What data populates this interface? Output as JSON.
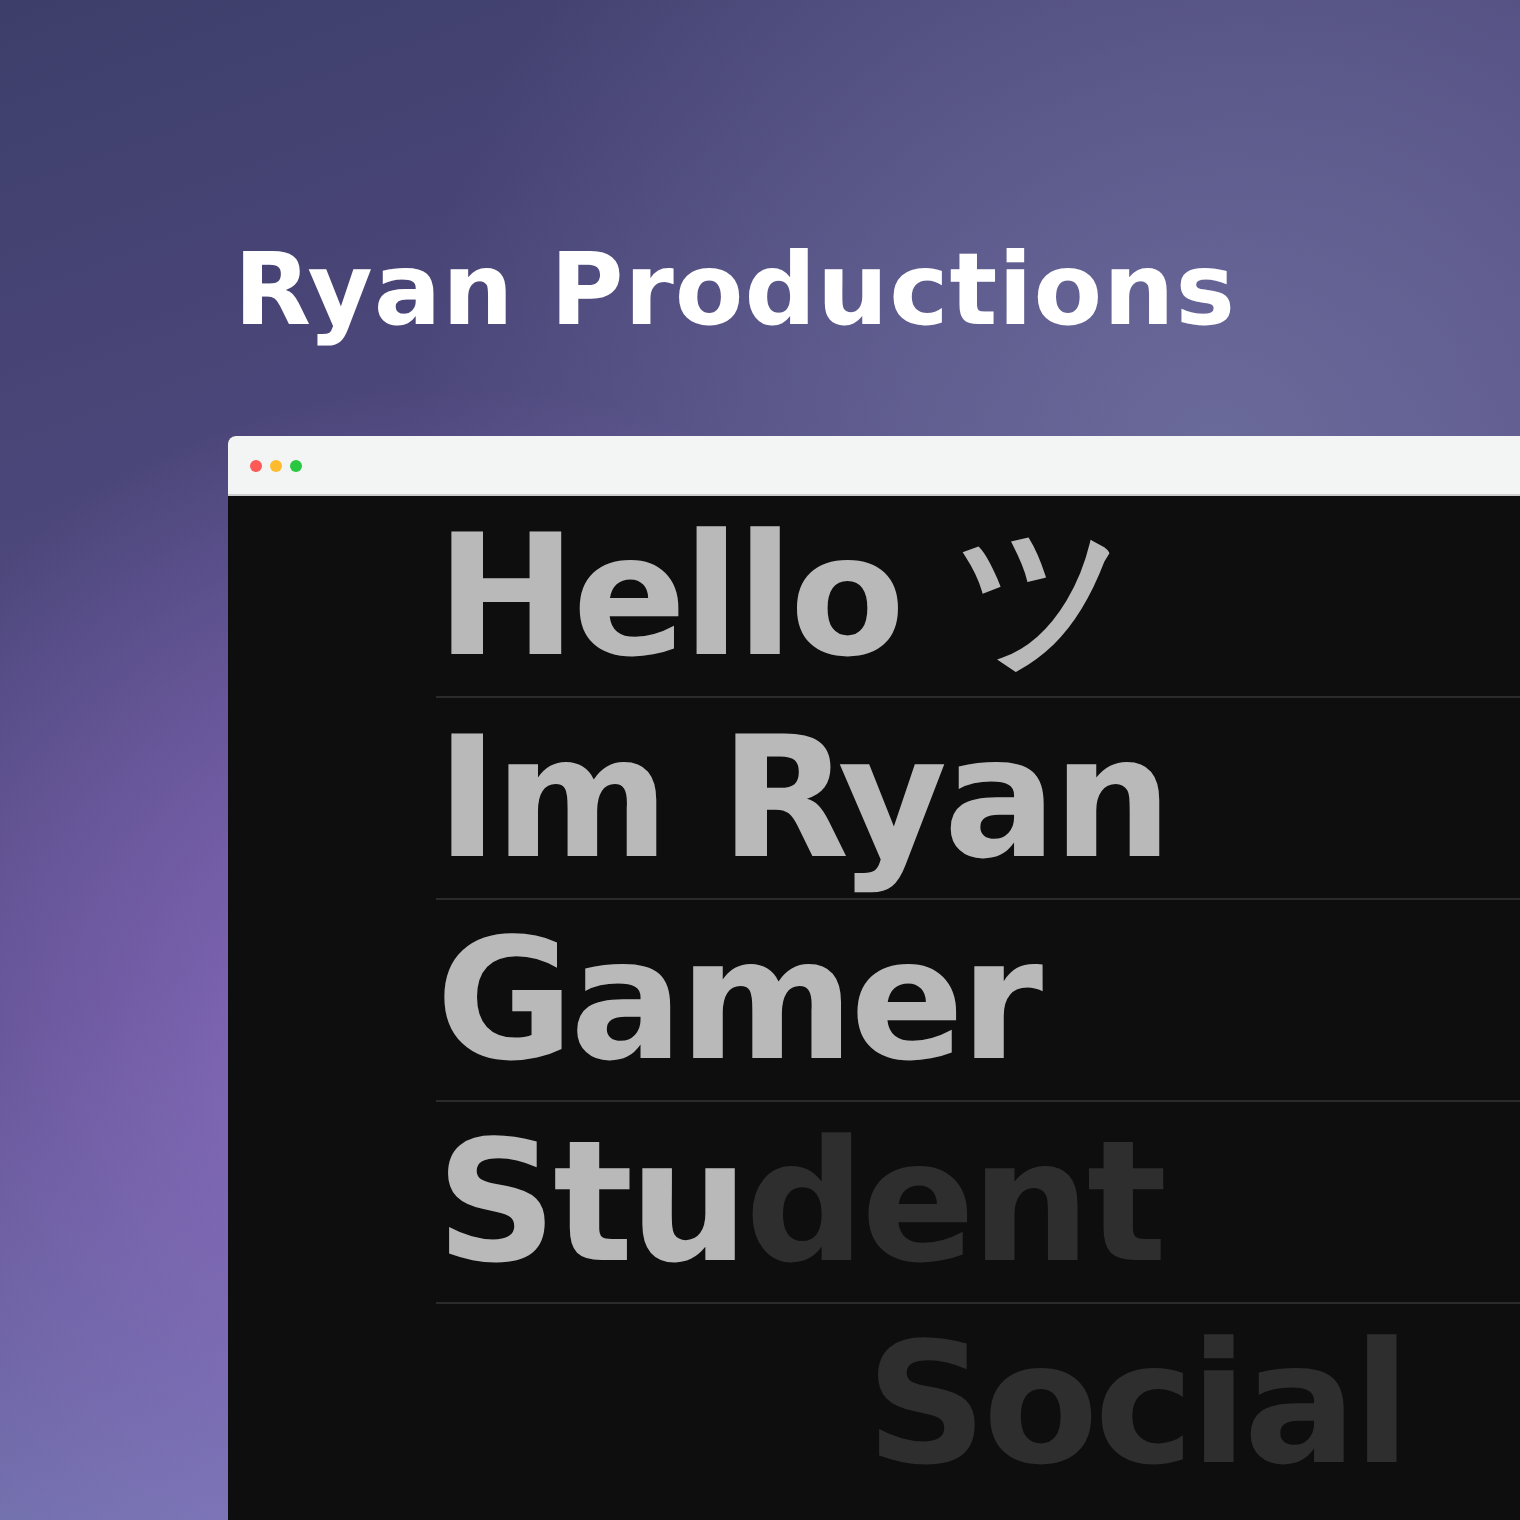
{
  "title": "Ryan Productions",
  "browser": {
    "lines": [
      {
        "kind": "static",
        "segments": [
          {
            "text": "Hello ツ",
            "lit": true
          }
        ]
      },
      {
        "kind": "static",
        "segments": [
          {
            "text": "Im Ryan",
            "lit": true
          }
        ]
      },
      {
        "kind": "static",
        "segments": [
          {
            "text": "Gamer",
            "lit": true
          }
        ]
      },
      {
        "kind": "static",
        "segments": [
          {
            "text": "Stu",
            "lit": true
          },
          {
            "text": "dent",
            "lit": false
          }
        ]
      },
      {
        "kind": "entering",
        "segments": [
          {
            "text": "Social",
            "lit": false
          }
        ]
      }
    ]
  }
}
